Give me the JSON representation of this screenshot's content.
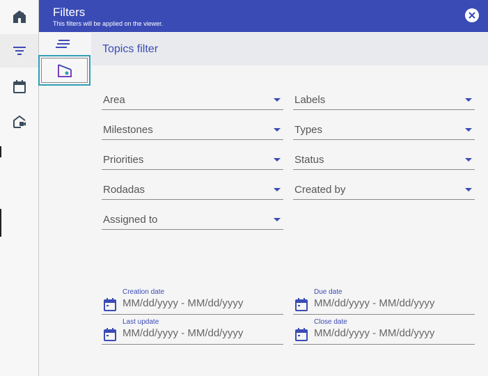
{
  "header": {
    "title": "Filters",
    "subtitle": "This filters will be applied on the viewer."
  },
  "section": {
    "title": "Topics filter"
  },
  "dropdowns": [
    {
      "label": "Area"
    },
    {
      "label": "Labels"
    },
    {
      "label": "Milestones"
    },
    {
      "label": "Types"
    },
    {
      "label": "Priorities"
    },
    {
      "label": "Status"
    },
    {
      "label": "Rodadas"
    },
    {
      "label": "Created by"
    },
    {
      "label": "Assigned to"
    }
  ],
  "dates": [
    {
      "caption": "Creation date",
      "placeholder": "MM/dd/yyyy - MM/dd/yyyy"
    },
    {
      "caption": "Due date",
      "placeholder": "MM/dd/yyyy - MM/dd/yyyy"
    },
    {
      "caption": "Last update",
      "placeholder": "MM/dd/yyyy - MM/dd/yyyy"
    },
    {
      "caption": "Close date",
      "placeholder": "MM/dd/yyyy - MM/dd/yyyy"
    }
  ],
  "rail": {
    "items": [
      "home-icon",
      "filter-icon",
      "calendar-icon",
      "camera-home-icon"
    ]
  },
  "colors": {
    "primary": "#3b4bb5",
    "accent": "#2e9fb6",
    "secondary": "#7b3fbf"
  }
}
